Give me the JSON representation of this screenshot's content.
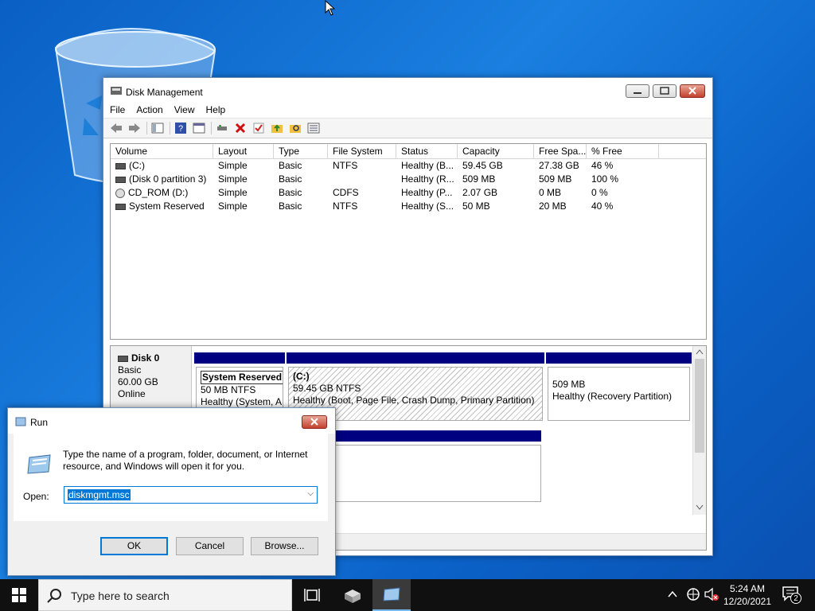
{
  "desktop": {
    "recycle_bin_icon": "recycle-bin-icon"
  },
  "disk_mgmt": {
    "title": "Disk Management",
    "menu": [
      "File",
      "Action",
      "View",
      "Help"
    ],
    "columns": [
      "Volume",
      "Layout",
      "Type",
      "File System",
      "Status",
      "Capacity",
      "Free Spa...",
      "% Free"
    ],
    "rows": [
      {
        "volume": "(C:)",
        "layout": "Simple",
        "type": "Basic",
        "fs": "NTFS",
        "status": "Healthy (B...",
        "capacity": "59.45 GB",
        "free": "27.38 GB",
        "pct": "46 %"
      },
      {
        "volume": "(Disk 0 partition 3)",
        "layout": "Simple",
        "type": "Basic",
        "fs": "",
        "status": "Healthy (R...",
        "capacity": "509 MB",
        "free": "509 MB",
        "pct": "100 %"
      },
      {
        "volume": "CD_ROM (D:)",
        "layout": "Simple",
        "type": "Basic",
        "fs": "CDFS",
        "status": "Healthy (P...",
        "capacity": "2.07 GB",
        "free": "0 MB",
        "pct": "0 %"
      },
      {
        "volume": "System Reserved",
        "layout": "Simple",
        "type": "Basic",
        "fs": "NTFS",
        "status": "Healthy (S...",
        "capacity": "50 MB",
        "free": "20 MB",
        "pct": "40 %"
      }
    ],
    "disk0": {
      "name": "Disk 0",
      "type": "Basic",
      "size": "60.00 GB",
      "state": "Online"
    },
    "partitions": [
      {
        "name": "System Reserved",
        "size": "50 MB NTFS",
        "status": "Healthy (System, A"
      },
      {
        "name": "(C:)",
        "size": "59.45 GB NTFS",
        "status": "Healthy (Boot, Page File, Crash Dump, Primary Partition)"
      },
      {
        "name": "",
        "size": "509 MB",
        "status": "Healthy (Recovery Partition)"
      }
    ]
  },
  "run": {
    "title": "Run",
    "description": "Type the name of a program, folder, document, or Internet resource, and Windows will open it for you.",
    "open_label": "Open:",
    "value": "diskmgmt.msc",
    "ok": "OK",
    "cancel": "Cancel",
    "browse": "Browse..."
  },
  "taskbar": {
    "search_placeholder": "Type here to search",
    "time": "5:24 AM",
    "date": "12/20/2021",
    "notification_count": "2"
  }
}
